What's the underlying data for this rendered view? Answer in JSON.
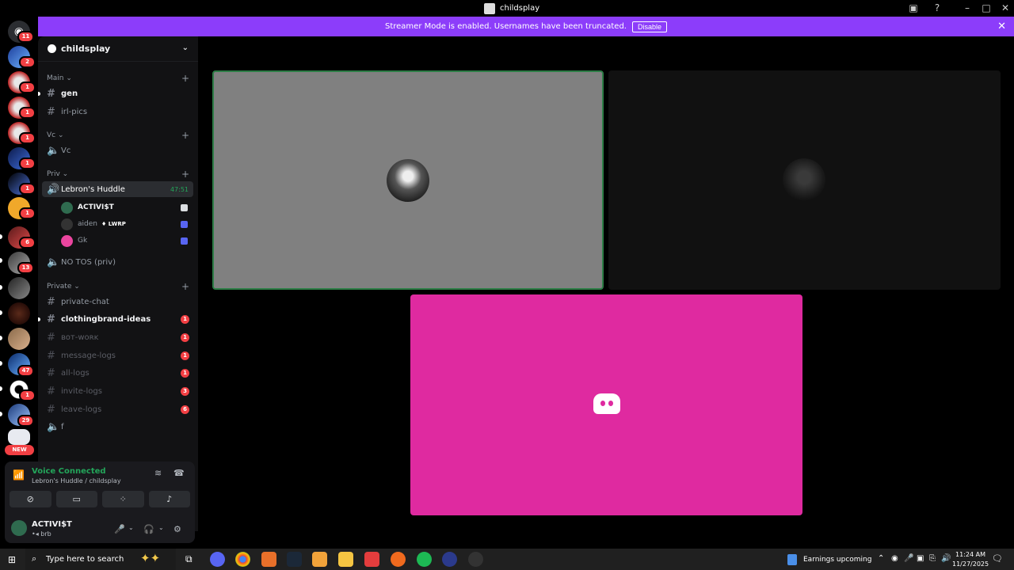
{
  "window": {
    "title": "childsplay"
  },
  "banner": {
    "text": "Streamer Mode is enabled. Usernames have been truncated.",
    "button": "Disable"
  },
  "rail": {
    "badges": [
      "11",
      "2",
      "1",
      "1",
      "1",
      "1",
      "1",
      "1",
      "6",
      "13",
      "47",
      "1",
      "29"
    ],
    "new_label": "NEW"
  },
  "guild": {
    "name": "childsplay"
  },
  "categories": {
    "main": "Main",
    "vc": "Vc",
    "priv": "Priv",
    "private": "Private"
  },
  "channels": {
    "gen": "gen",
    "irl_pics": "irl-pics",
    "vc": "Vc",
    "lebrons_huddle": "Lebron's Huddle",
    "huddle_timer": "47:51",
    "no_tos": "NO TOS (priv)",
    "private_chat": "private-chat",
    "clothingbrand": "clothingbrand-ideas",
    "clothingbrand_badge": "1",
    "bot_work": "ʙᴏᴛ-ᴡᴏʀᴋ",
    "bot_work_badge": "1",
    "message_logs": "message-logs",
    "message_logs_badge": "1",
    "all_logs": "all-logs",
    "all_logs_badge": "1",
    "invite_logs": "invite-logs",
    "invite_logs_badge": "3",
    "leave_logs": "leave-logs",
    "leave_logs_badge": "6",
    "f": "f"
  },
  "voice_users": [
    {
      "name": "ACTIVI$T"
    },
    {
      "name": "aiden",
      "tag": "LWRP"
    },
    {
      "name": "Gk"
    }
  ],
  "voice_panel": {
    "status": "Voice Connected",
    "location": "Lebron's Huddle / childsplay"
  },
  "user": {
    "name": "ACTIVI$T",
    "status": "brb"
  },
  "taskbar": {
    "search_placeholder": "Type here to search",
    "news": "Earnings upcoming",
    "time": "11:24 AM",
    "date": "11/27/2025"
  },
  "colors": {
    "accent_purple": "#8c3dfa",
    "online_green": "#23a55a",
    "badge_red": "#f23f43",
    "tile_pink": "#df2aa0"
  }
}
